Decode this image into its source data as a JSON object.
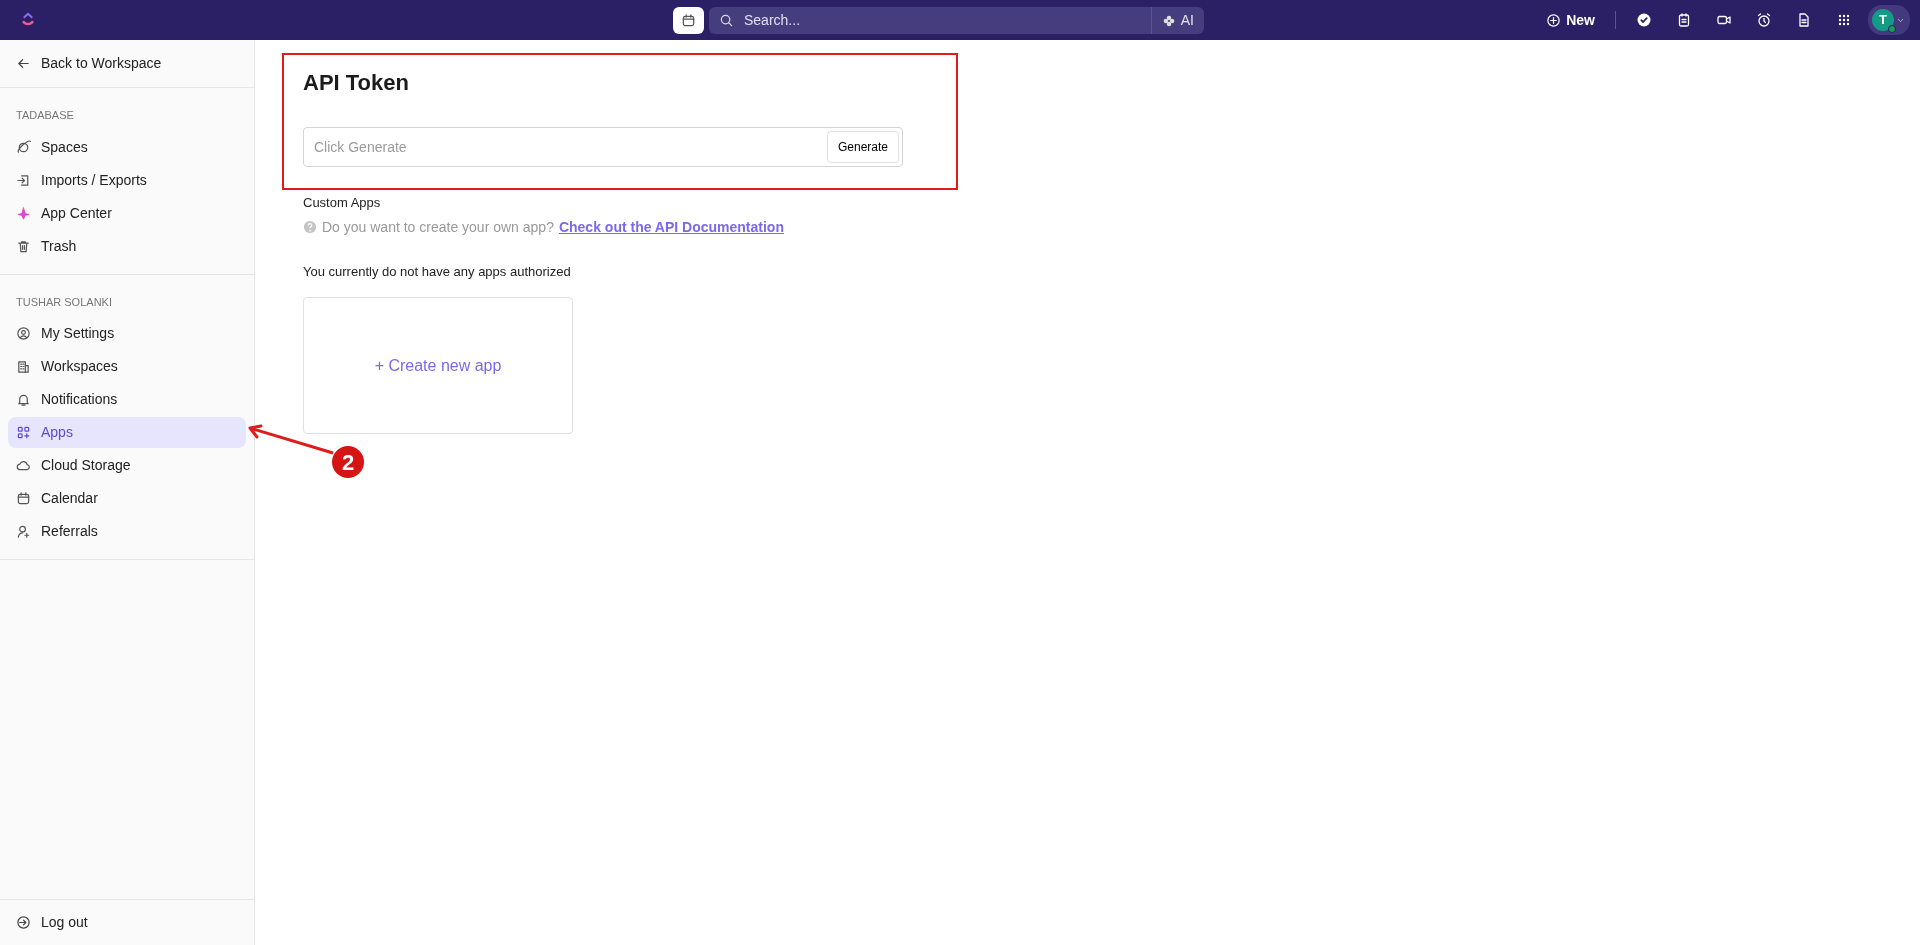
{
  "topbar": {
    "search": {
      "placeholder": "Search..."
    },
    "ai_label": "AI",
    "new_label": "New",
    "avatar_initial": "T"
  },
  "sidebar": {
    "back_label": "Back to Workspace",
    "sections": [
      {
        "title": "TADABASE",
        "items": [
          {
            "label": "Spaces",
            "selected": false
          },
          {
            "label": "Imports / Exports",
            "selected": false
          },
          {
            "label": "App Center",
            "selected": false
          },
          {
            "label": "Trash",
            "selected": false
          }
        ]
      },
      {
        "title": "TUSHAR SOLANKI",
        "items": [
          {
            "label": "My Settings",
            "selected": false
          },
          {
            "label": "Workspaces",
            "selected": false
          },
          {
            "label": "Notifications",
            "selected": false
          },
          {
            "label": "Apps",
            "selected": true
          },
          {
            "label": "Cloud Storage",
            "selected": false
          },
          {
            "label": "Calendar",
            "selected": false
          },
          {
            "label": "Referrals",
            "selected": false
          }
        ]
      }
    ],
    "logout_label": "Log out"
  },
  "api_token": {
    "title": "API Token",
    "field": {
      "placeholder": "Click Generate"
    },
    "button": "Generate"
  },
  "custom_apps": {
    "title": "Custom Apps",
    "help_text": "Do you want to create your own app?",
    "link": "Check out the API Documentation",
    "empty_text": "You currently do not have any apps authorized",
    "create_label": "+ Create new app"
  },
  "annotation": {
    "step_number": "2"
  }
}
